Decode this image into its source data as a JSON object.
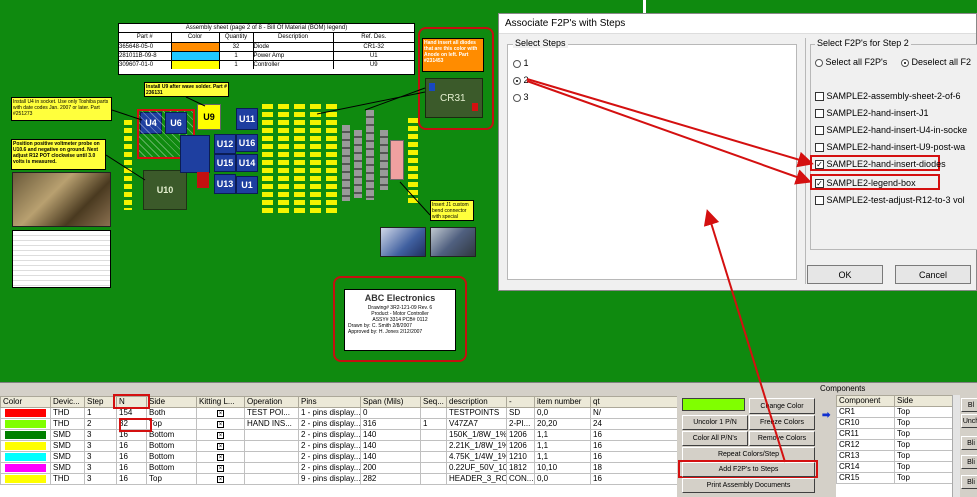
{
  "assembly_sheet": {
    "title": "Assembly sheet (page 2 of 8 - Bill Of Material (BOM) legend)",
    "headers": [
      "Part #",
      "Color",
      "Quantity",
      "Description",
      "Ref. Des."
    ],
    "rows": [
      {
        "part": "365648-05-0",
        "color": "#ff8c00",
        "qty": "32",
        "desc": "Diode",
        "ref": "CR1-32"
      },
      {
        "part": "281011B-09-8",
        "color": "#20c8ff",
        "qty": "1",
        "desc": "Power Amp",
        "ref": "U1"
      },
      {
        "part": "309607-01-0",
        "color": "#ffff00",
        "qty": "1",
        "desc": "Controller",
        "ref": "U9"
      }
    ]
  },
  "notes": {
    "diodes": "Hand insert all diodes that are this color with Anode on left.  Part #231453",
    "u9": "Install U9 after wave solder. Part # 236131",
    "u4": "Install U4 in socket. Use only Toshiba parts with date codes Jan. 2007 or later. Part #251273",
    "probe": "Position positive voltmeter probe on U10.6 and negative on ground. Next adjust R12 POT clockwise until 3.0 volts is measured.",
    "j1": "Insert J1 custom bend connector with special"
  },
  "components_labels": {
    "cr31": "CR31",
    "u4": "U4",
    "u6": "U6",
    "u9": "U9",
    "u10": "U10",
    "u11": "U11",
    "u12": "U12",
    "u13": "U13",
    "u14": "U14",
    "u15": "U15",
    "u16": "U16",
    "u1": "U1"
  },
  "title_block": {
    "company": "ABC Electronics",
    "lines": [
      "Drawing# 3R2-121-09     Rev. 6",
      "Product - Motor Controller",
      "ASSY# 3314    PCB# 0112",
      "Drawn by: C. Smith  2/8/2007",
      "Approved by: H. Jones  2/12/2007"
    ]
  },
  "dialog": {
    "title": "Associate F2P's with Steps",
    "select_steps_label": "Select Steps",
    "steps": [
      "1",
      "2",
      "3"
    ],
    "selected_step": "2",
    "select_f2p_label": "Select F2P's for Step 2",
    "select_all": "Select all F2P's",
    "deselect_all": "Deselect all F2",
    "f2p_items": [
      {
        "label": "SAMPLE2-assembly-sheet-2-of-6",
        "checked": false
      },
      {
        "label": "SAMPLE2-hand-insert-J1",
        "checked": false
      },
      {
        "label": "SAMPLE2-hand-insert-U4-in-socke",
        "checked": false
      },
      {
        "label": "SAMPLE2-hand-insert-U9-post-wa",
        "checked": false
      },
      {
        "label": "SAMPLE2-hand-insert-diodes",
        "checked": true
      },
      {
        "label": "SAMPLE2-legend-box",
        "checked": true
      },
      {
        "label": "SAMPLE2-test-adjust-R12-to-3 vol",
        "checked": false
      }
    ],
    "ok": "OK",
    "cancel": "Cancel"
  },
  "bom_grid": {
    "headers": [
      "Color",
      "Devic...",
      "Step",
      "N",
      "Side",
      "Kitting L...",
      "Operation",
      "Pins",
      "Span (Mils)",
      "Seq...",
      "description",
      "-",
      "item number",
      "qt"
    ],
    "rows": [
      {
        "color": "#ff0000",
        "dev": "THD",
        "step": "1",
        "n": "154",
        "side": "Both",
        "kit": "☒",
        "op": "TEST POI...",
        "pins": "1 - pins display...",
        "span": "0",
        "seq": "",
        "desc": "TESTPOINTS",
        "dash": "SD",
        "item": "0,0",
        "qt": "N/"
      },
      {
        "color": "#80ff00",
        "dev": "THD",
        "step": "2",
        "n": "32",
        "side": "Top",
        "kit": "☒",
        "op": "HAND INS...",
        "pins": "2 - pins display...",
        "span": "316",
        "seq": "1",
        "desc": "V47ZA7",
        "dash": "2-PI...",
        "item": "20,20",
        "qt": "24"
      },
      {
        "color": "#008000",
        "dev": "SMD",
        "step": "3",
        "n": "16",
        "side": "Bottom",
        "kit": "☒",
        "op": "",
        "pins": "2 - pins display...",
        "span": "140",
        "seq": "",
        "desc": "150K_1/8W_1%",
        "dash": "1206",
        "item": "1,1",
        "qt": "16"
      },
      {
        "color": "#ffff00",
        "dev": "SMD",
        "step": "3",
        "n": "16",
        "side": "Bottom",
        "kit": "☒",
        "op": "",
        "pins": "2 - pins display...",
        "span": "140",
        "seq": "",
        "desc": "2.21K_1/8W_1%",
        "dash": "1206",
        "item": "1,1",
        "qt": "16"
      },
      {
        "color": "#00ffff",
        "dev": "SMD",
        "step": "3",
        "n": "16",
        "side": "Bottom",
        "kit": "☒",
        "op": "",
        "pins": "2 - pins display...",
        "span": "140",
        "seq": "",
        "desc": "4.75K_1/4W_1%",
        "dash": "1210",
        "item": "1,1",
        "qt": "16"
      },
      {
        "color": "#ff00ff",
        "dev": "SMD",
        "step": "3",
        "n": "16",
        "side": "Bottom",
        "kit": "☒",
        "op": "",
        "pins": "2 - pins display...",
        "span": "200",
        "seq": "",
        "desc": "0.22UF_50V_10%",
        "dash": "1812",
        "item": "10,10",
        "qt": "18"
      },
      {
        "color": "#ffff00",
        "dev": "THD",
        "step": "3",
        "n": "16",
        "side": "Top",
        "kit": "☒",
        "op": "",
        "pins": "9 - pins display...",
        "span": "282",
        "seq": "",
        "desc": "HEADER_3_ROWS",
        "dash": "CON...",
        "item": "0,0",
        "qt": "16"
      }
    ]
  },
  "color_panel": {
    "change_color": "Change Color",
    "uncolor": "Uncolor 1 P/N",
    "freeze": "Freeze Colors",
    "color_all": "Color All P/N's",
    "remove": "Remove Colors",
    "repeat": "Repeat Colors/Step",
    "add_f2p": "Add F2P's to Steps",
    "print": "Print Assembly Documents",
    "swatch": "#80ff00"
  },
  "components_panel": {
    "title": "Components",
    "headers": [
      "Component",
      "Side"
    ],
    "rows": [
      {
        "c": "CR1",
        "s": "Top"
      },
      {
        "c": "CR10",
        "s": "Top"
      },
      {
        "c": "CR11",
        "s": "Top"
      },
      {
        "c": "CR12",
        "s": "Top"
      },
      {
        "c": "CR13",
        "s": "Top"
      },
      {
        "c": "CR14",
        "s": "Top"
      },
      {
        "c": "CR15",
        "s": "Top"
      }
    ],
    "side_buttons": [
      "Bl",
      "Unch",
      "Bli",
      "Bli",
      "Bli"
    ]
  }
}
